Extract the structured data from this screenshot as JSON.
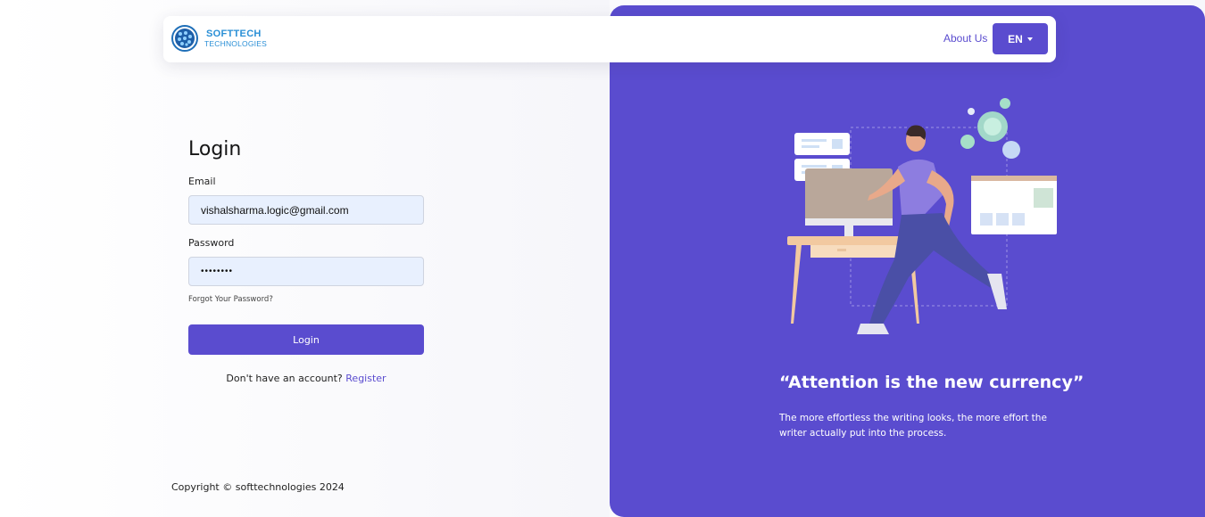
{
  "brand": {
    "logo_line1": "SOFTTECH",
    "logo_line2": "TECHNOLOGIES"
  },
  "nav": {
    "about_label": "About Us",
    "lang_label": "EN"
  },
  "login": {
    "title": "Login",
    "email_label": "Email",
    "email_value": "vishalsharma.logic@gmail.com",
    "password_label": "Password",
    "password_value": "••••••••",
    "forgot_label": "Forgot Your Password?",
    "submit_label": "Login",
    "register_prompt": "Don't have an account?",
    "register_label": "Register"
  },
  "footer": {
    "copyright": "Copyright © softtechnologies 2024"
  },
  "promo": {
    "quote_title": "“Attention is the new currency”",
    "quote_body": "The more effortless the writing looks, the more effort the writer actually put into the process."
  },
  "colors": {
    "accent": "#5a4ccf",
    "input_bg": "#e8f0fe",
    "logo_blue": "#2a8fd6"
  },
  "icons": {
    "logo": "globe-dots-icon",
    "lang_dropdown": "caret-down-icon"
  }
}
